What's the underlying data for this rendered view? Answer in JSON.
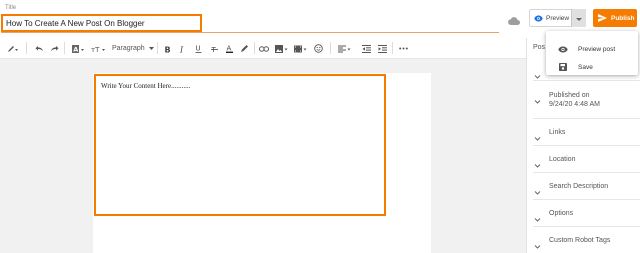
{
  "title": {
    "label": "Title",
    "value": "How To Create A New Post On Blogger"
  },
  "actions": {
    "preview_label": "Preview",
    "publish_label": "Publish"
  },
  "menu": {
    "items": [
      {
        "label": "Preview post",
        "icon": "eye-icon"
      },
      {
        "label": "Save",
        "icon": "save-icon"
      }
    ]
  },
  "toolbar": {
    "paragraph_label": "Paragraph"
  },
  "editor": {
    "content": "Write Your Content Here..........."
  },
  "sidebar": {
    "header": "Pos",
    "items": [
      {
        "label": "",
        "icon": "chevron-down-icon"
      },
      {
        "label": "Published on",
        "sub": "9/24/20 4:48 AM"
      },
      {
        "label": "Links"
      },
      {
        "label": "Location"
      },
      {
        "label": "Search Description"
      },
      {
        "label": "Options"
      },
      {
        "label": "Custom Robot Tags"
      }
    ]
  },
  "colors": {
    "accent": "#f57c00",
    "editor_bg": "#f1f1f1"
  }
}
